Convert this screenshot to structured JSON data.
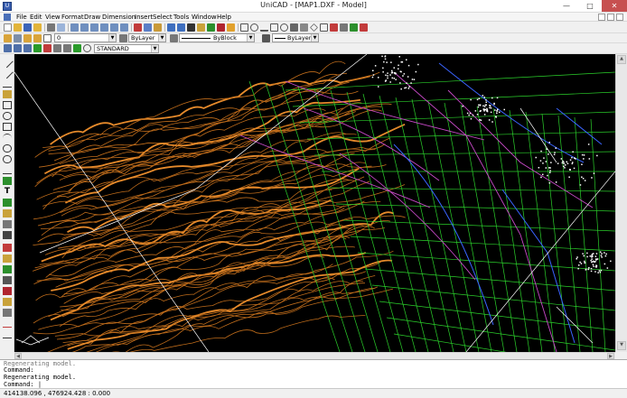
{
  "window": {
    "title": "UniCAD - [MAP1.DXF - Model]",
    "app_icon": "unicad-app-icon",
    "minimize": "—",
    "maximize": "□",
    "close": "✕"
  },
  "menu": [
    "File",
    "Edit",
    "View",
    "Format",
    "Draw",
    "Dimension",
    "Insert",
    "Select",
    "Tools",
    "Window",
    "Help"
  ],
  "toolbar2": {
    "layer_value": "0",
    "color_value": "ByLayer",
    "linetype_value": "ByBlock",
    "lineweight_value": "ByLayer"
  },
  "toolbar3": {
    "textstyle_value": "STANDARD"
  },
  "command": {
    "lines": [
      "Regenerating model.",
      "Command:",
      "Regenerating model.",
      "Command:  |"
    ]
  },
  "status": {
    "coordinates": "414138.096 , 476924.428 : 0.000"
  },
  "colors": {
    "canvas_bg": "#000000",
    "contour": "#d4781e",
    "road": "#c94ac9",
    "river": "#3a64ff",
    "grid": "#2bd12b",
    "building": "#ffffff",
    "close_button": "#c75050"
  }
}
